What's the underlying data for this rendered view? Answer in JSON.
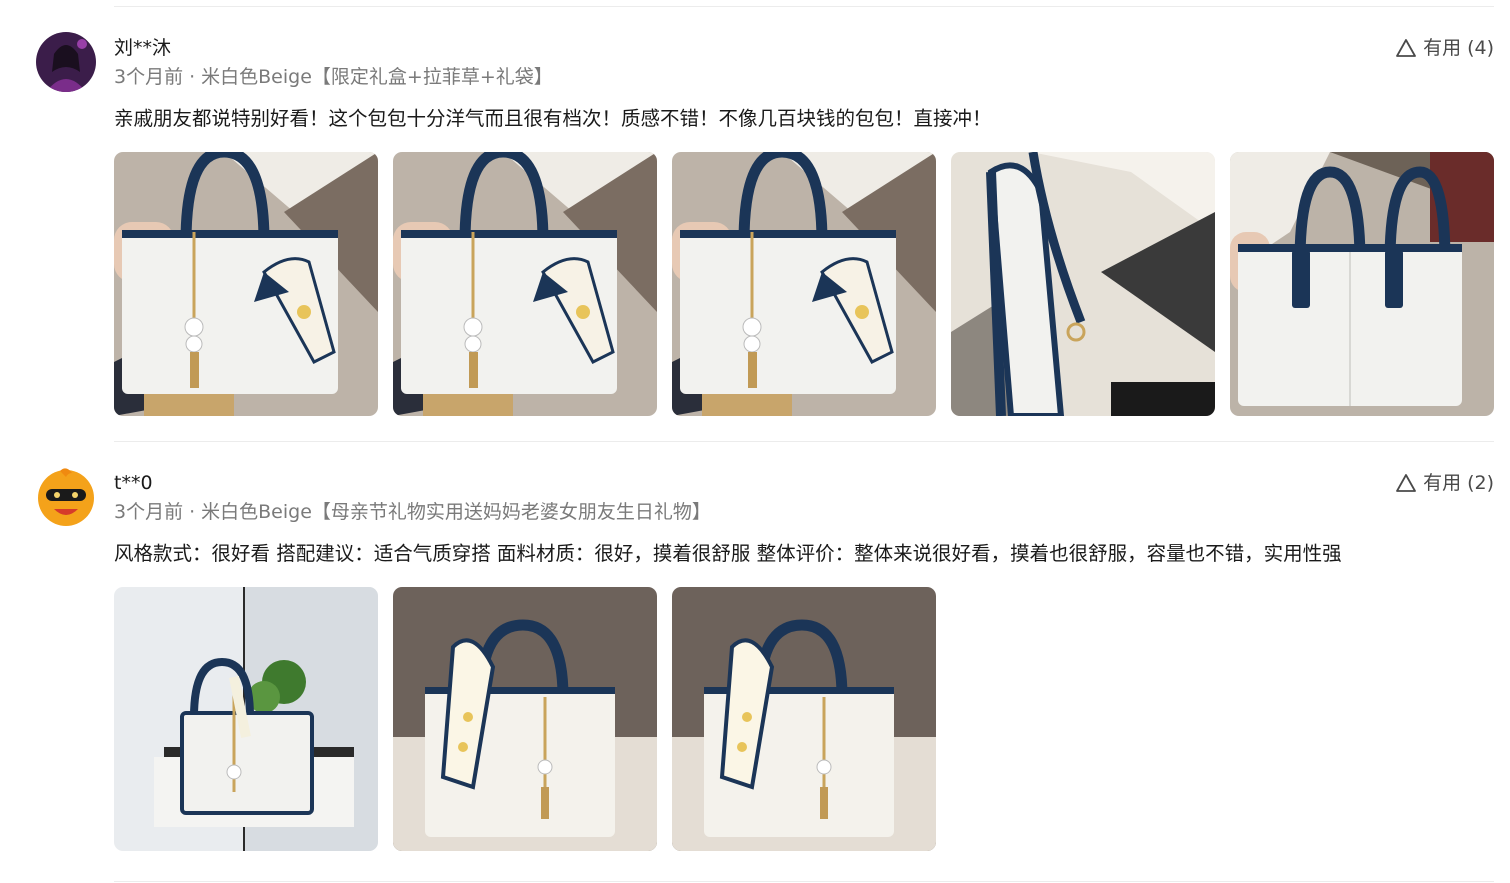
{
  "reviews": [
    {
      "username": "刘**沐",
      "time": "3个月前",
      "separator": "·",
      "variant": "米白色Beige【限定礼盒+拉菲草+礼袋】",
      "useful_label": "有用",
      "useful_count": "(4)",
      "content": "亲戚朋友都说特别好看！这个包包十分洋气而且很有档次！质感不错！不像几百块钱的包包！直接冲！",
      "photo_count": 5
    },
    {
      "username": "t**0",
      "time": "3个月前",
      "separator": "·",
      "variant": "米白色Beige【母亲节礼物实用送妈妈老婆女朋友生日礼物】",
      "useful_label": "有用",
      "useful_count": "(2)",
      "content": "风格款式：很好看 搭配建议：适合气质穿搭 面料材质：很好，摸着很舒服 整体评价：整体来说很好看，摸着也很舒服，容量也不错，实用性强",
      "photo_count": 3
    }
  ],
  "icons": {
    "useful": "thumb-up-outline-icon"
  },
  "colors": {
    "bag_body": "#f2f2ef",
    "bag_trim": "#1b3557",
    "text_secondary": "#7a7a7a"
  }
}
